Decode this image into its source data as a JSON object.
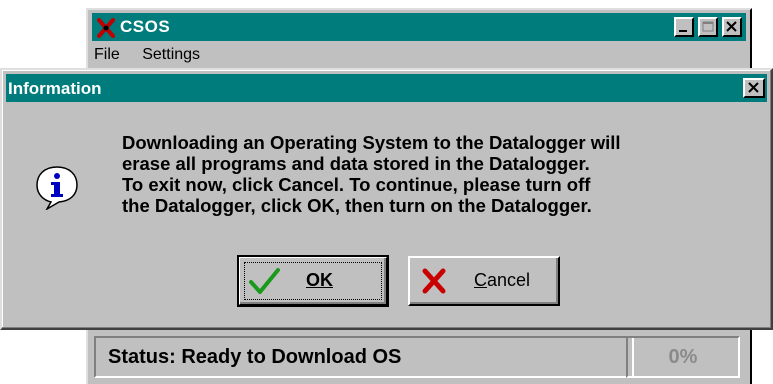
{
  "main_window": {
    "title": "CSOS",
    "menu": [
      "File",
      "Settings"
    ],
    "status_text": "Status:  Ready to Download OS",
    "progress_text": "0%"
  },
  "dialog": {
    "title": "Information",
    "icon": "info-icon",
    "message": "Downloading an Operating System to the Datalogger will\nerase all programs and data stored in the Datalogger.\nTo exit now, click Cancel. To continue, please turn off\nthe Datalogger, click OK, then turn on the Datalogger.",
    "ok_label": "OK",
    "cancel_label": "Cancel"
  },
  "colors": {
    "titlebar": "#007c7c",
    "face": "#c0c0c0",
    "check": "#1a9a1a",
    "x_mark": "#c80000",
    "info_blue": "#0000c0"
  }
}
